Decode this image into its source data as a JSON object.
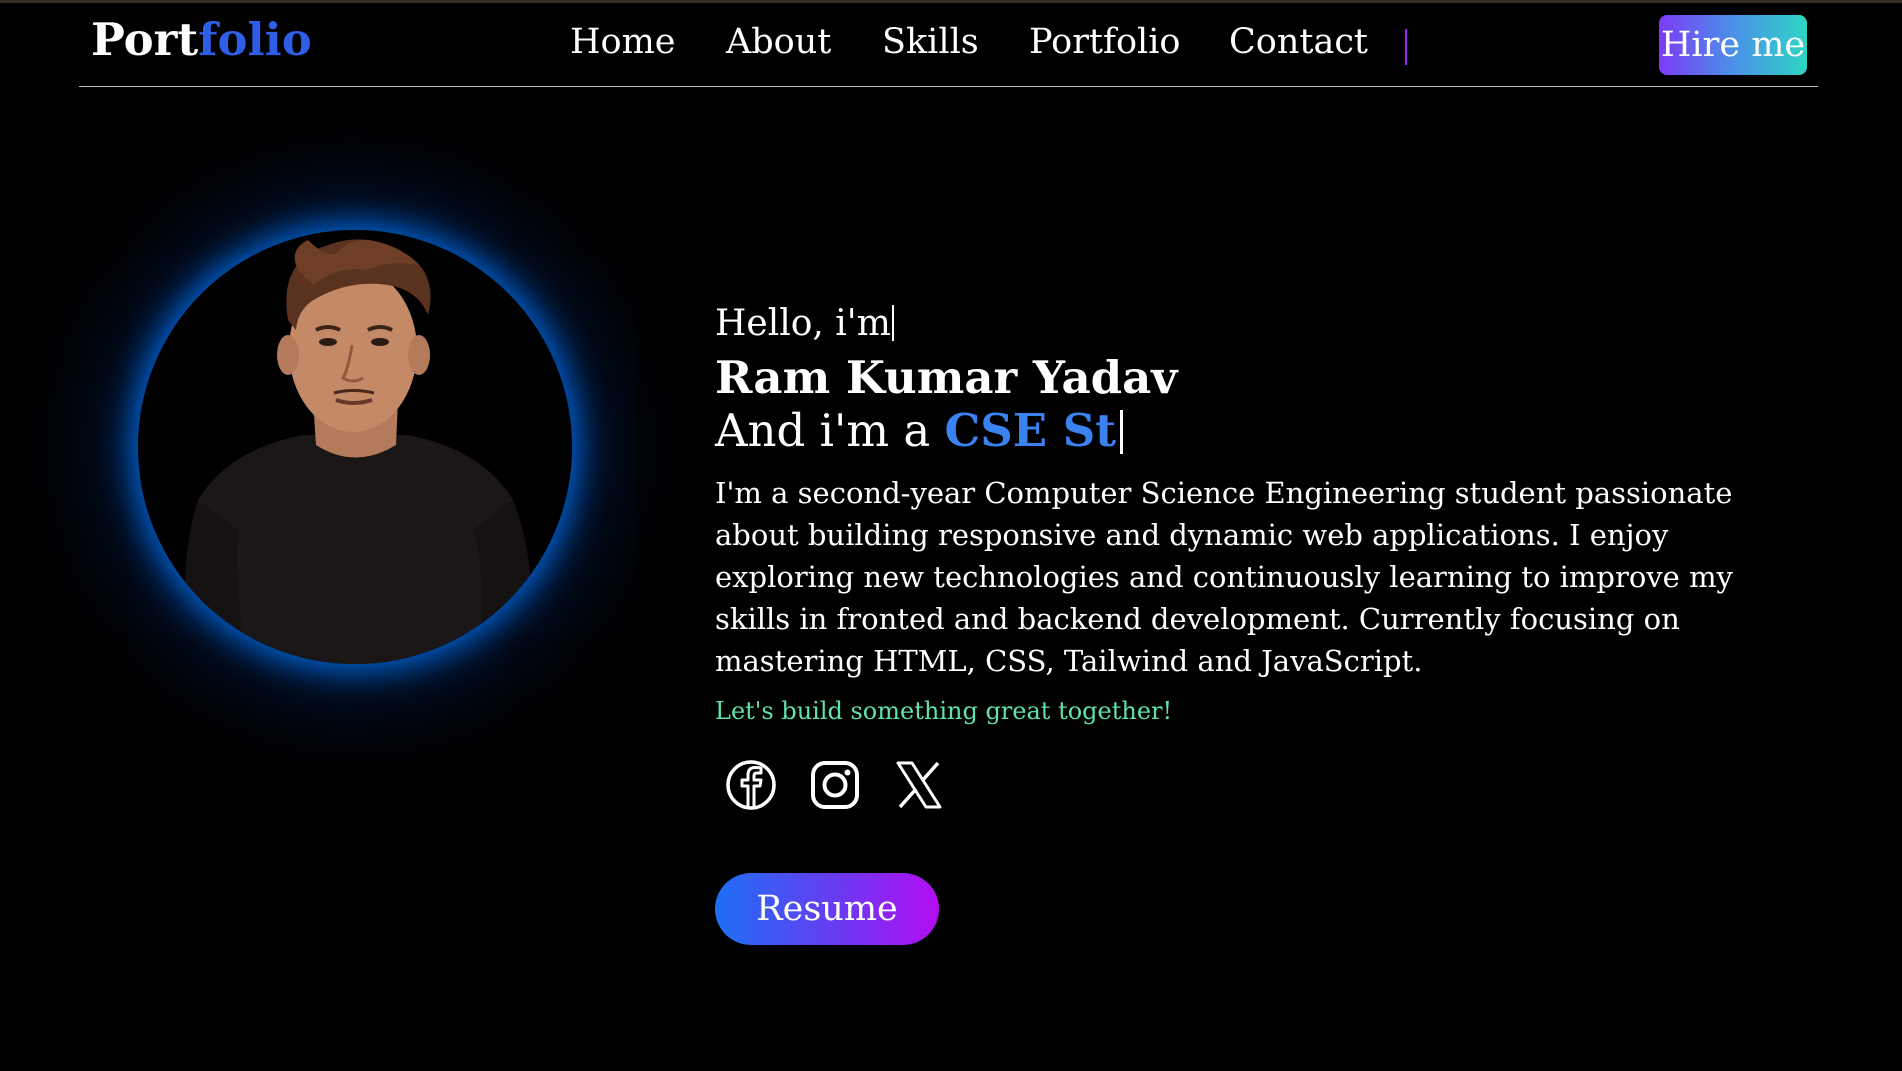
{
  "header": {
    "logo_part1": "Port",
    "logo_part2": "folio",
    "nav": [
      "Home",
      "About",
      "Skills",
      "Portfolio",
      "Contact"
    ],
    "hire_label": "Hire me"
  },
  "hero": {
    "greeting": "Hello, i'm",
    "name": "Ram Kumar Yadav",
    "role_prefix": "And i'm a ",
    "role_typed": "CSE St",
    "bio": "I'm a second-year Computer Science Engineering student passionate about building responsive and dynamic web applications. I enjoy exploring new technologies and continuously learning to improve my skills in fronted and backend development. Currently focusing on mastering HTML, CSS, Tailwind and JavaScript.",
    "tagline": "Let's build something great together!",
    "resume_label": "Resume",
    "socials": [
      "facebook-icon",
      "instagram-icon",
      "x-twitter-icon"
    ]
  },
  "colors": {
    "background": "#000000",
    "logo_accent": "#2f5ee6",
    "role_accent": "#3a82f0",
    "tagline": "#5fe3a8",
    "divider": "#a020f0"
  }
}
